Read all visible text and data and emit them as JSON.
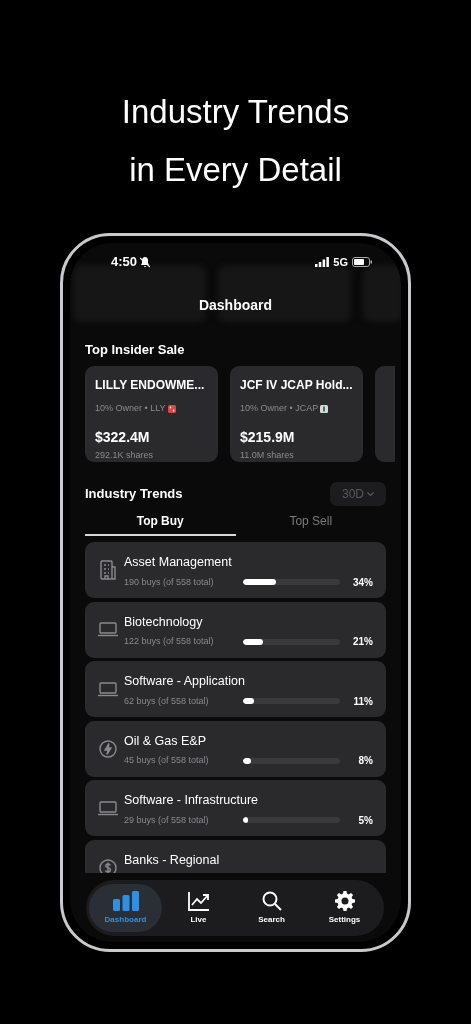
{
  "headline": [
    "Industry Trends",
    "in Every Detail"
  ],
  "status_bar": {
    "time": "4:50",
    "network": "5G"
  },
  "title": "Dashboard",
  "insider_section": {
    "title": "Top Insider Sale",
    "cards": [
      {
        "name": "LILLY ENDOWME...",
        "role": "10% Owner • LLY",
        "kind": "dice",
        "amount": "$322.4M",
        "shares": "292.1K shares"
      },
      {
        "name": "JCF IV JCAP Hold...",
        "role": "10% Owner • JCAP",
        "kind": "book",
        "amount": "$215.9M",
        "shares": "11.0M shares"
      }
    ]
  },
  "trends": {
    "title": "Industry Trends",
    "period": "30D",
    "tabs": [
      {
        "label": "Top Buy",
        "selected": true
      },
      {
        "label": "Top Sell",
        "selected": false
      }
    ],
    "rows": [
      {
        "kind": "building",
        "name": "Asset Management",
        "detail": "190 buys (of 558 total)",
        "level": 0.34,
        "percent": "34%"
      },
      {
        "kind": "laptop",
        "name": "Biotechnology",
        "detail": "122 buys (of 558 total)",
        "level": 0.21,
        "percent": "21%"
      },
      {
        "kind": "laptop",
        "name": "Software - Application",
        "detail": "62 buys (of 558 total)",
        "level": 0.11,
        "percent": "11%"
      },
      {
        "kind": "bolt",
        "name": "Oil & Gas E&P",
        "detail": "45 buys (of 558 total)",
        "level": 0.08,
        "percent": "8%"
      },
      {
        "kind": "laptop",
        "name": "Software - Infrastructure",
        "detail": "29 buys (of 558 total)",
        "level": 0.05,
        "percent": "5%"
      },
      {
        "kind": "dollar",
        "name": "Banks - Regional"
      }
    ]
  },
  "tab_bar": [
    {
      "kind": "bars",
      "label": "Dashboard",
      "selected": true
    },
    {
      "kind": "chart",
      "label": "Live",
      "selected": false
    },
    {
      "kind": "search",
      "label": "Search",
      "selected": false
    },
    {
      "kind": "gear",
      "label": "Settings",
      "selected": false
    }
  ]
}
